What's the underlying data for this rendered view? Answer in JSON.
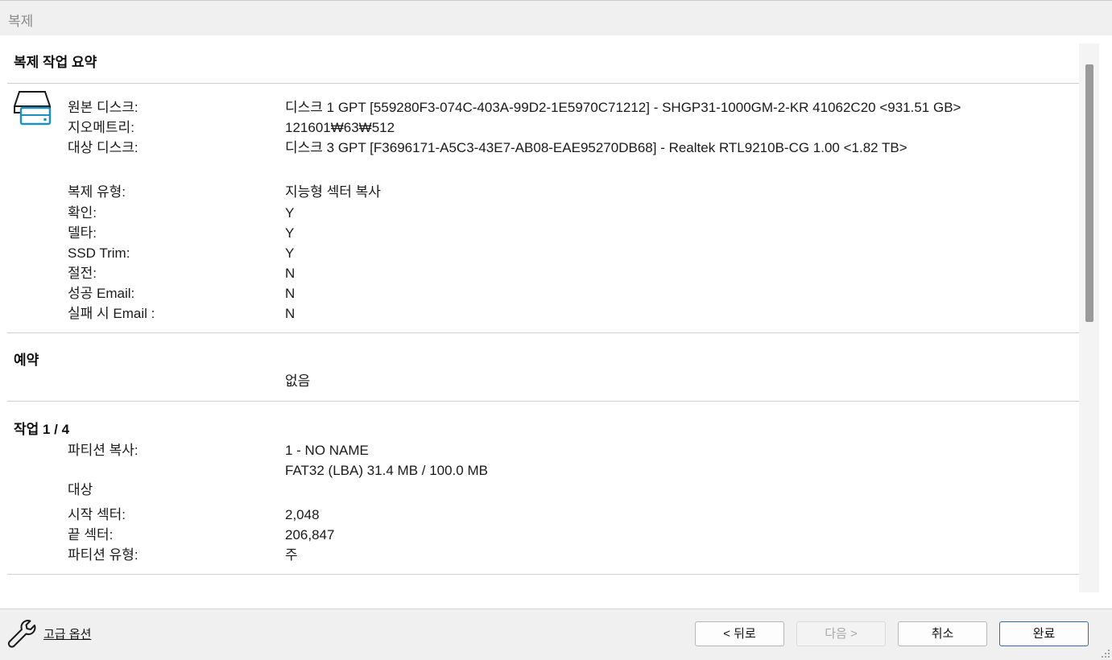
{
  "window": {
    "title": "복제"
  },
  "summary": {
    "title": "복제 작업 요약",
    "disk_rows": [
      {
        "label": "원본 디스크:",
        "value": "디스크 1 GPT [559280F3-074C-403A-99D2-1E5970C71212] - SHGP31-1000GM-2-KR 41062C20  <931.51 GB>"
      },
      {
        "label": "지오메트리:",
        "value": "121601₩63₩512"
      },
      {
        "label": "대상 디스크:",
        "value": "디스크 3 GPT [F3696171-A5C3-43E7-AB08-EAE95270DB68] - Realtek  RTL9210B-CG       1.00  <1.82 TB>"
      }
    ],
    "option_rows": [
      {
        "label": "복제 유형:",
        "value": "지능형 섹터 복사"
      },
      {
        "label": "확인:",
        "value": "Y"
      },
      {
        "label": "델타:",
        "value": "Y"
      },
      {
        "label": "SSD Trim:",
        "value": "Y"
      },
      {
        "label": "절전:",
        "value": "N"
      },
      {
        "label": "성공 Email:",
        "value": "N"
      },
      {
        "label": "실패 시 Email :",
        "value": "N"
      }
    ]
  },
  "schedule": {
    "title": "예약",
    "value": "없음"
  },
  "task": {
    "title": "작업 1 / 4",
    "partition_copy_label": "파티션 복사:",
    "partition_name": "1 - NO NAME",
    "partition_info": "FAT32 (LBA) 31.4 MB / 100.0 MB",
    "target_label": "대상",
    "rows": [
      {
        "label": "시작 섹터:",
        "value": "2,048"
      },
      {
        "label": "끝 섹터:",
        "value": "206,847"
      },
      {
        "label": "파티션 유형:",
        "value": "주"
      }
    ]
  },
  "footer": {
    "advanced_label": "고급 옵션",
    "back_label": "< 뒤로",
    "next_label": "다음 >",
    "cancel_label": "취소",
    "finish_label": "완료"
  },
  "icons": [
    "disk-icon",
    "wrench-icon",
    "resize-grip-icon"
  ],
  "colors": {
    "disk_icon_accent": "#1e8fbf",
    "primary_border": "#2f6db5"
  }
}
